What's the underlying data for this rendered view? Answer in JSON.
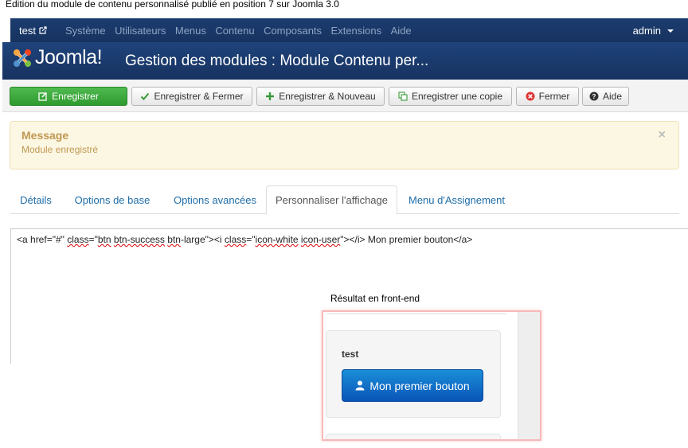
{
  "caption": "Edition du module de contenu personnalisé publié en position 7 sur Joomla 3.0",
  "topnav": {
    "site": "test",
    "menu": [
      "Système",
      "Utilisateurs",
      "Menus",
      "Contenu",
      "Composants",
      "Extensions",
      "Aide"
    ],
    "user": "admin"
  },
  "header": {
    "logo": "Joomla!",
    "title": "Gestion des modules : Module Contenu per..."
  },
  "toolbar": {
    "save": "Enregistrer",
    "save_close": "Enregistrer & Fermer",
    "save_new": "Enregistrer & Nouveau",
    "save_copy": "Enregistrer une copie",
    "close": "Fermer",
    "help": "Aide"
  },
  "alert": {
    "heading": "Message",
    "text": "Module enregistré",
    "close": "×"
  },
  "tabs": [
    "Détails",
    "Options de base",
    "Options avancées",
    "Personnaliser l'affichage",
    "Menu d'Assignement"
  ],
  "editor": {
    "p1": "<a href=\"#\" ",
    "w1": "class",
    "p2": "=\"",
    "w2": "btn",
    "p3": " ",
    "w3": "btn-success",
    "p4": " ",
    "w4": "btn",
    "p5": "-large\"><i ",
    "w5": "class",
    "p6": "=\"",
    "w6": "icon-white",
    "p7": " ",
    "w7": "icon-user",
    "p8": "\"></i> Mon premier bouton</a>"
  },
  "result": {
    "label": "Résultat en front-end",
    "module_title": "test",
    "button": "Mon premier bouton"
  },
  "colors": {
    "nav_bg": "#1a3867",
    "success": "#3aa53a",
    "primary": "#0a6fcb",
    "alert_bg": "#fcf7e3"
  }
}
